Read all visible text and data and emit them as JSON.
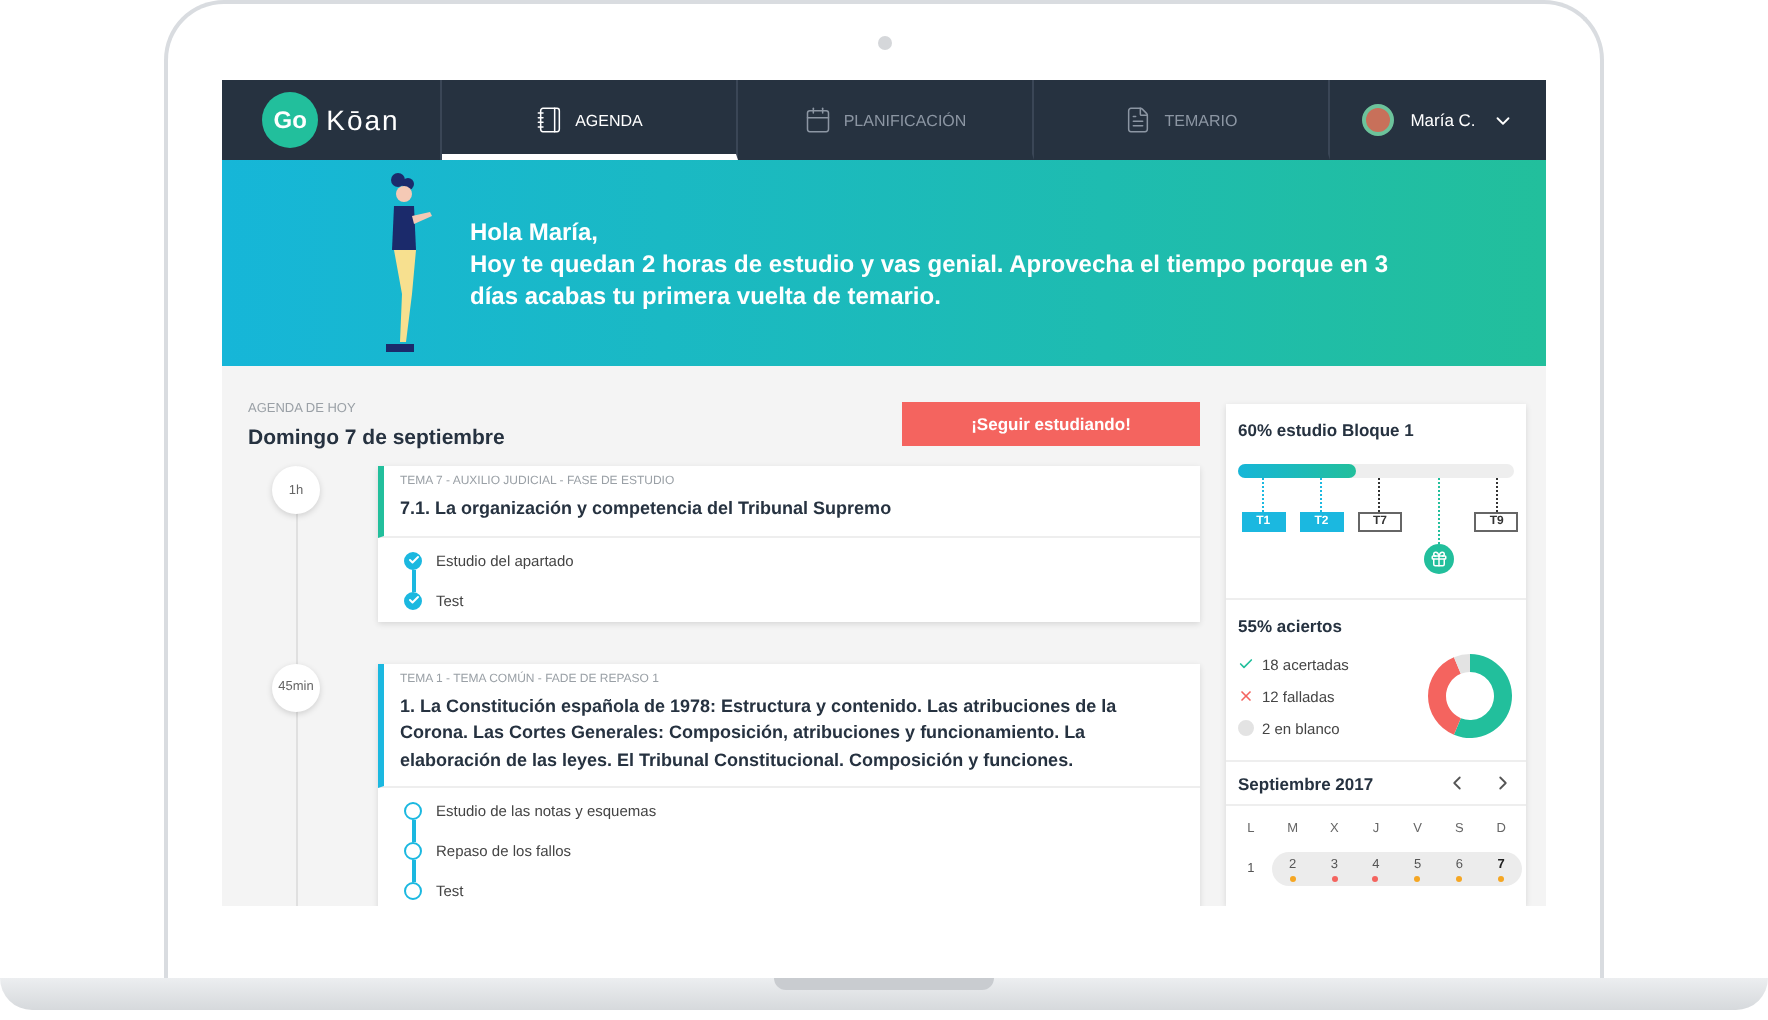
{
  "brand": {
    "prefix": "Go",
    "name": "Kōan"
  },
  "nav": {
    "tabs": [
      {
        "label": "AGENDA",
        "selected": true
      },
      {
        "label": "PLANIFICACIÓN",
        "selected": false
      },
      {
        "label": "TEMARIO",
        "selected": false
      }
    ],
    "user": {
      "name": "María C."
    }
  },
  "banner": {
    "greeting": "Hola María,",
    "message": "Hoy te quedan 2 horas de estudio y vas genial. Aprovecha el tiempo porque en 3 días acabas tu primera vuelta de temario."
  },
  "agenda": {
    "caption": "AGENDA DE HOY",
    "date": "Domingo 7 de septiembre",
    "action": "¡Seguir estudiando!",
    "sessions": [
      {
        "duration": "1h",
        "color": "#22bf9c",
        "meta": "TEMA 7 - AUXILIO JUDICIAL - FASE DE ESTUDIO",
        "title": "7.1.  La organización y competencia del Tribunal Supremo",
        "tasks": [
          {
            "label": "Estudio del apartado",
            "done": true
          },
          {
            "label": "Test",
            "done": true
          }
        ]
      },
      {
        "duration": "45min",
        "color": "#1bb8e0",
        "meta": "TEMA 1 - TEMA COMÚN - FADE DE REPASO 1",
        "title": "1. La Constitución española de 1978: Estructura y contenido. Las atribuciones de la Corona. Las Cortes Generales: Composición, atribuciones y funcionamiento. La elaboración de las leyes. El Tribunal Constitucional. Composición y funciones.",
        "tasks": [
          {
            "label": "Estudio de las notas y esquemas",
            "done": false
          },
          {
            "label": "Repaso de los fallos",
            "done": false
          },
          {
            "label": "Test",
            "done": false
          }
        ]
      }
    ]
  },
  "progress": {
    "title": "60% estudio Bloque 1",
    "level": 0.43,
    "markers": [
      {
        "kind": "topic",
        "label": "T1",
        "reached": true
      },
      {
        "kind": "topic",
        "label": "T2",
        "reached": true
      },
      {
        "kind": "topic",
        "label": "T7",
        "reached": false
      },
      {
        "kind": "milestone"
      },
      {
        "kind": "topic",
        "label": "T9",
        "reached": false
      }
    ]
  },
  "results": {
    "title": "55% aciertos",
    "items": [
      {
        "kind": "correct",
        "label": "18 acertadas",
        "color": "#22bf9c"
      },
      {
        "kind": "wrong",
        "label": "12 falladas",
        "color": "#f4645f"
      },
      {
        "kind": "blank",
        "label": "2 en blanco",
        "color": "#e3e3e3"
      }
    ],
    "chart_data": {
      "type": "donut",
      "values": [
        56.25,
        37.5,
        6.25
      ]
    }
  },
  "calendar": {
    "month": "Septiembre 2017",
    "weekdays": [
      "L",
      "M",
      "X",
      "J",
      "V",
      "S",
      "D"
    ],
    "days": [
      {
        "label": "1",
        "in_week": false,
        "selected": false
      },
      {
        "label": "2",
        "in_week": true,
        "selected": false,
        "color": "#f5a623"
      },
      {
        "label": "3",
        "in_week": true,
        "selected": false,
        "color": "#f4645f"
      },
      {
        "label": "4",
        "in_week": true,
        "selected": false,
        "color": "#f4645f"
      },
      {
        "label": "5",
        "in_week": true,
        "selected": false,
        "color": "#f5a623"
      },
      {
        "label": "6",
        "in_week": true,
        "selected": false,
        "color": "#f5a623"
      },
      {
        "label": "7",
        "in_week": true,
        "selected": true,
        "color": "#f5a623"
      }
    ]
  }
}
